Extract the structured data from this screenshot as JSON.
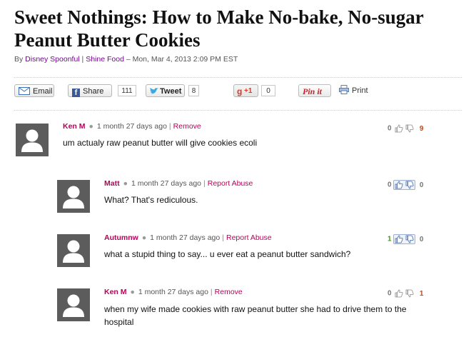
{
  "article": {
    "title": "Sweet Nothings: How to Make No-bake, No-sugar Peanut Butter Cookies",
    "byline_prefix": "By ",
    "author": "Disney Spoonful",
    "byline_sep": " | ",
    "section": "Shine Food",
    "date": " – Mon, Mar 4, 2013 2:09 PM EST"
  },
  "share": {
    "email_label": "Email",
    "facebook_label": "Share",
    "facebook_count": "111",
    "twitter_label": "Tweet",
    "twitter_count": "8",
    "gplus_label": "+1",
    "gplus_count": "0",
    "pinit_label": "Pin it",
    "print_label": "Print"
  },
  "comments": [
    {
      "name": "Ken M",
      "time": "1 month 27 days ago",
      "action": "Remove",
      "text": "um actualy raw peanut butter will give cookies ecoli",
      "up": "0",
      "down": "9"
    },
    {
      "name": "Matt",
      "time": "1 month 27 days ago",
      "action": "Report Abuse",
      "text": "What? That's rediculous.",
      "up": "0",
      "down": "0"
    },
    {
      "name": "Autumnw",
      "time": "1 month 27 days ago",
      "action": "Report Abuse",
      "text": "what a stupid thing to say... u ever eat a peanut butter sandwich?",
      "up": "1",
      "down": "0"
    },
    {
      "name": "Ken M",
      "time": "1 month 27 days ago",
      "action": "Remove",
      "text": "when my wife made cookies with raw peanut butter she had to drive them to the hospital",
      "up": "0",
      "down": "1"
    }
  ],
  "colors": {
    "accent": "#b8005a",
    "link": "#7b0099",
    "up_green": "#3a9a18",
    "down_red": "#c0481c"
  }
}
